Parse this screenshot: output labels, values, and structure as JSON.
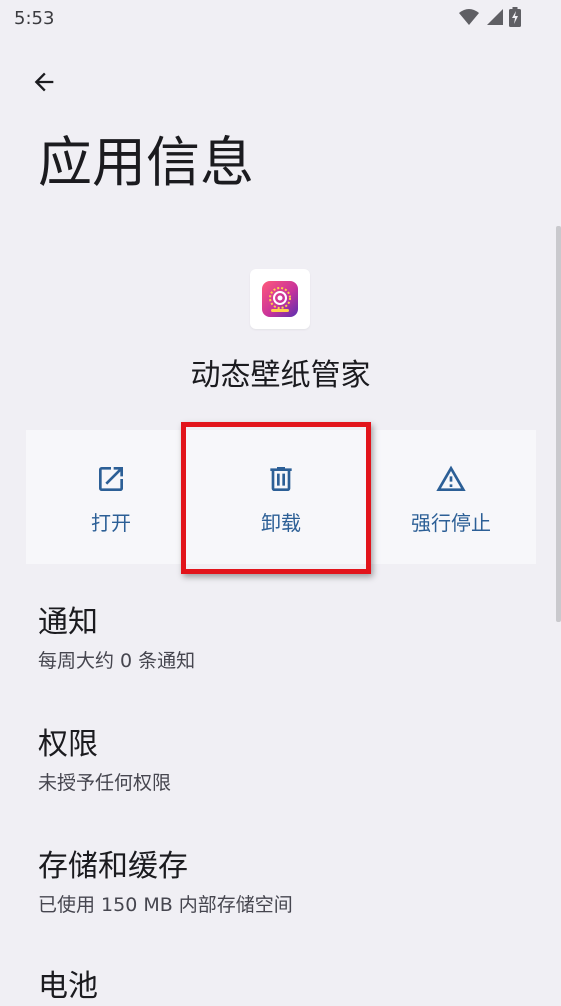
{
  "status_bar": {
    "time": "5:53"
  },
  "header": {
    "title": "应用信息"
  },
  "app": {
    "name": "动态壁纸管家"
  },
  "actions": [
    {
      "label": "打开",
      "icon": "open-external-icon"
    },
    {
      "label": "卸载",
      "icon": "trash-icon"
    },
    {
      "label": "强行停止",
      "icon": "warning-icon"
    }
  ],
  "settings": [
    {
      "title": "通知",
      "subtitle": "每周大约 0 条通知"
    },
    {
      "title": "权限",
      "subtitle": "未授予任何权限"
    },
    {
      "title": "存储和缓存",
      "subtitle": "已使用 150 MB 内部存储空间"
    },
    {
      "title": "电池"
    }
  ],
  "colors": {
    "background": "#f0eff4",
    "accent": "#2c5f96",
    "highlight": "#e2141b"
  }
}
